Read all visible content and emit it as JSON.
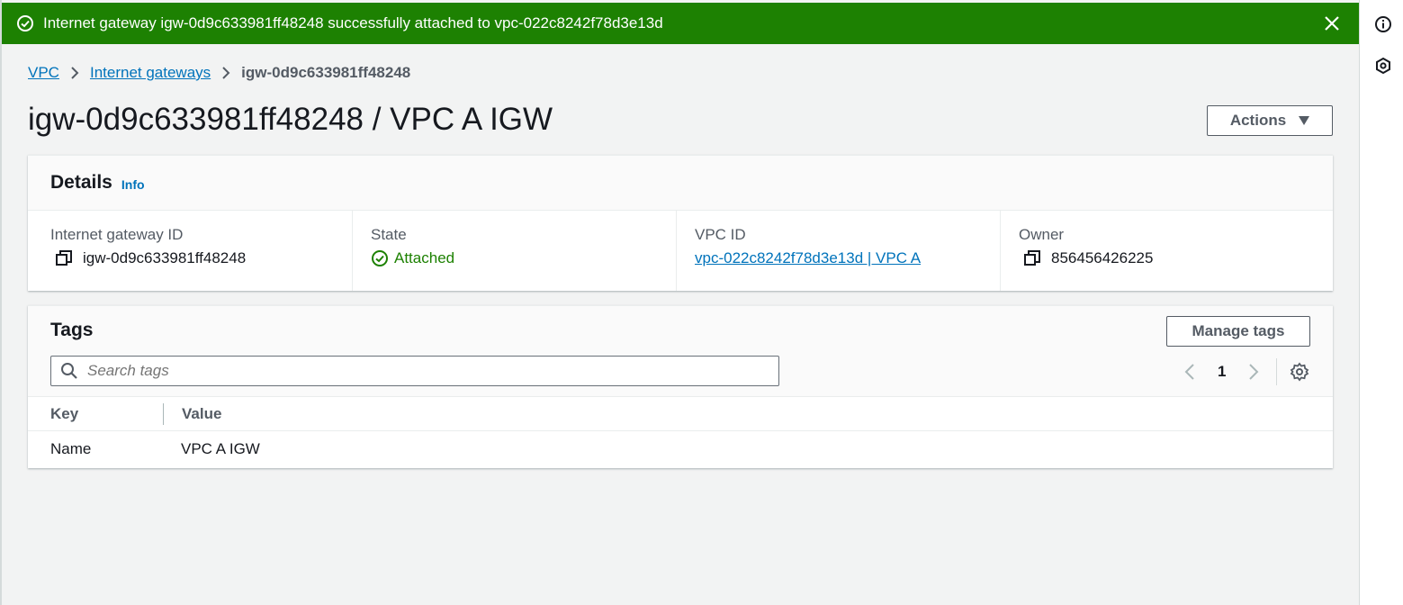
{
  "flash": {
    "message": "Internet gateway igw-0d9c633981ff48248 successfully attached to vpc-022c8242f78d3e13d",
    "status_color": "#1d8102"
  },
  "breadcrumb": {
    "items": [
      "VPC",
      "Internet gateways"
    ],
    "current": "igw-0d9c633981ff48248"
  },
  "header": {
    "title": "igw-0d9c633981ff48248 / VPC A IGW",
    "actions_label": "Actions"
  },
  "details": {
    "title": "Details",
    "info_label": "Info",
    "fields": {
      "igw_id": {
        "label": "Internet gateway ID",
        "value": "igw-0d9c633981ff48248"
      },
      "state": {
        "label": "State",
        "value": "Attached"
      },
      "vpc_id": {
        "label": "VPC ID",
        "value": "vpc-022c8242f78d3e13d | VPC A"
      },
      "owner": {
        "label": "Owner",
        "value": "856456426225"
      }
    }
  },
  "tags": {
    "title": "Tags",
    "manage_label": "Manage tags",
    "search_placeholder": "Search tags",
    "page": "1",
    "columns": [
      "Key",
      "Value"
    ],
    "rows": [
      {
        "key": "Name",
        "value": "VPC A IGW"
      }
    ]
  },
  "icons": [
    "success-icon",
    "close-icon",
    "info-icon",
    "settings-hex-icon",
    "chevron-right-icon",
    "caret-down-icon",
    "copy-icon",
    "status-ok-icon",
    "search-icon",
    "chevron-left-icon",
    "gear-icon"
  ],
  "colors": {
    "link": "#0073bb",
    "success": "#1d8102"
  }
}
